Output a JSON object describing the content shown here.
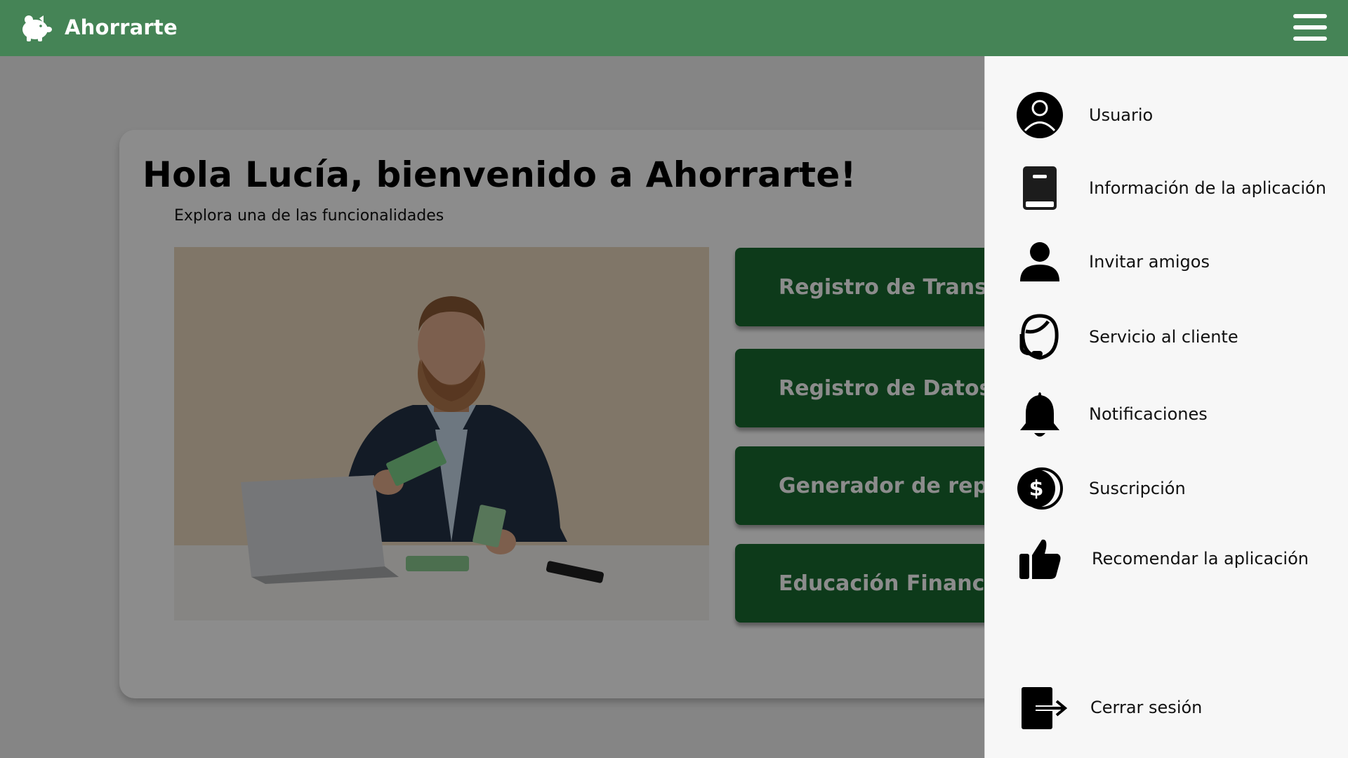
{
  "header": {
    "app_name": "Ahorrarte",
    "logo_icon": "piggy-bank-icon",
    "menu_icon": "hamburger-menu-icon",
    "background_color": "#458456"
  },
  "main": {
    "greeting": "Hola Lucía, bienvenido a Ahorrarte!",
    "subtitle": "Explora una de las funcionalidades",
    "hero_image": "man-counting-money-at-laptop",
    "features": [
      {
        "label": "Registro de Transacciones"
      },
      {
        "label": "Registro de Datos Financieros"
      },
      {
        "label": "Generador de reportes"
      },
      {
        "label": "Educación Financiera"
      }
    ],
    "feature_color": "#186b30"
  },
  "drawer": {
    "items": [
      {
        "label": "Usuario",
        "icon": "user-circle-icon"
      },
      {
        "label": "Información de la aplicación",
        "icon": "book-icon"
      },
      {
        "label": "Invitar amigos",
        "icon": "person-icon"
      },
      {
        "label": "Servicio al cliente",
        "icon": "headset-icon"
      },
      {
        "label": "Notificaciones",
        "icon": "bell-icon"
      },
      {
        "label": "Suscripción",
        "icon": "coin-dollar-icon"
      },
      {
        "label": "Recomendar la aplicación",
        "icon": "thumbs-up-icon"
      }
    ],
    "logout": {
      "label": "Cerrar sesión",
      "icon": "logout-icon"
    }
  }
}
